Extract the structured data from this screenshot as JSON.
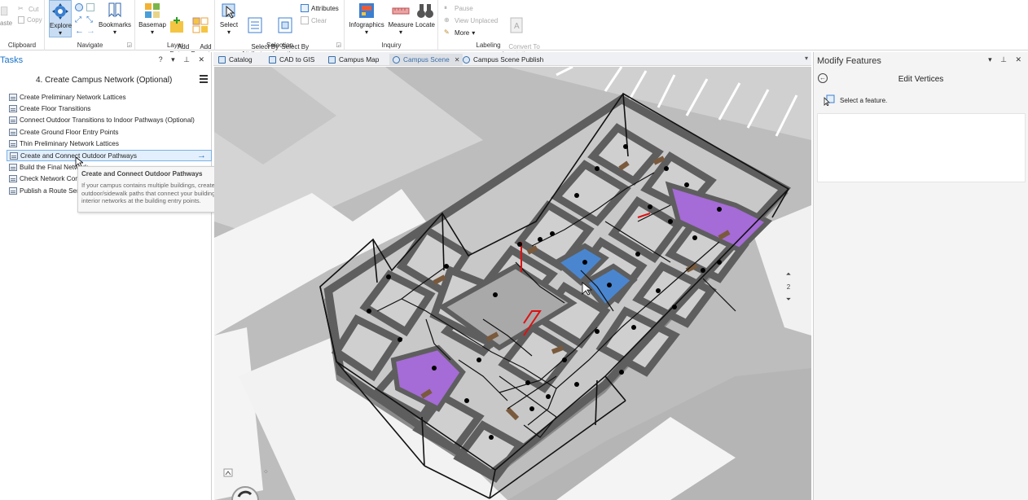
{
  "ribbon": {
    "clipboard": {
      "paste": "aste",
      "cut": "Cut",
      "copy": "Copy",
      "group": "Clipboard"
    },
    "navigate": {
      "explore": "Explore",
      "bookmarks": "Bookmarks",
      "group": "Navigate"
    },
    "layer": {
      "basemap": "Basemap",
      "add_data": "Add\nData",
      "add_preset": "Add\nPreset",
      "group": "Layer"
    },
    "selection": {
      "select": "Select",
      "by_attributes": "Select By\nAttributes",
      "by_location": "Select By\nLocation",
      "attributes": "Attributes",
      "clear": "Clear",
      "group": "Selection"
    },
    "inquiry": {
      "infographics": "Infographics",
      "measure": "Measure",
      "locate": "Locate",
      "group": "Inquiry"
    },
    "labeling": {
      "pause": "Pause",
      "view_unplaced": "View Unplaced",
      "more": "More",
      "convert": "Convert To\nAnnotation",
      "group": "Labeling"
    }
  },
  "tasks_panel": {
    "title": "Tasks",
    "controls": "? ▾ ⊥ ✕",
    "task_title": "4. Create Campus Network (Optional)",
    "items": [
      {
        "label": "Create Preliminary Network Lattices"
      },
      {
        "label": "Create Floor Transitions"
      },
      {
        "label": "Connect Outdoor Transitions to Indoor Pathways (Optional)"
      },
      {
        "label": "Create Ground Floor Entry Points"
      },
      {
        "label": "Thin Preliminary Network Lattices"
      },
      {
        "label": "Create and Connect Outdoor Pathways"
      },
      {
        "label": "Build the Final Network"
      },
      {
        "label": "Check Network Connectivity"
      },
      {
        "label": "Publish a Route Service"
      }
    ],
    "tooltip": {
      "title": "Create and Connect Outdoor Pathways",
      "body": "If your campus contains multiple buildings, create outdoor/sidewalk paths that connect your building interior networks at the building entry points."
    }
  },
  "tabs": [
    {
      "label": "Catalog"
    },
    {
      "label": "CAD to GIS"
    },
    {
      "label": "Campus Map"
    },
    {
      "label": "Campus Scene"
    },
    {
      "label": "Campus Scene Publish"
    }
  ],
  "map": {
    "floor_number": "2"
  },
  "modify_panel": {
    "title": "Modify Features",
    "controls": "▾ ⊥ ✕",
    "heading": "Edit Vertices",
    "instruction": "Select a feature."
  },
  "colors": {
    "accent": "#1a73c8",
    "purple_room": "#a56bd6",
    "blue_room": "#4a86d0",
    "wall": "#5f5f5f",
    "floor": "#c9c9c9"
  }
}
